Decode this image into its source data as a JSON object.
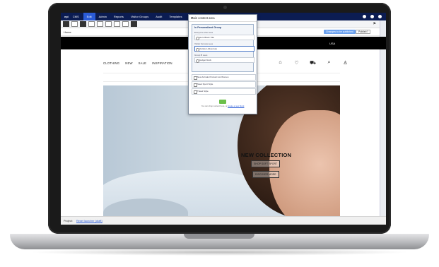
{
  "cms": {
    "logo": "epi",
    "apps_label": "CMS",
    "nav": [
      "Edit",
      "Admin",
      "Reports",
      "Visitor Groups",
      "Audit",
      "Templates"
    ],
    "active_tab": "Edit"
  },
  "page": {
    "home_label": "Home",
    "publish_status": "Changes to be published",
    "publish_button": "Publish?"
  },
  "site": {
    "locale": "USA",
    "menu": [
      "CLOTHING",
      "NEW",
      "SALE",
      "INSPIRATION"
    ],
    "icons": [
      "store-icon",
      "wishlist-icon",
      "cart-icon",
      "search-icon",
      "user-icon"
    ],
    "hero": {
      "title": "NEW COLLECTION",
      "primary_button": "SHOP SOFT SPORT",
      "secondary_button": "DISCOVER MORE"
    }
  },
  "modal": {
    "title": "Main content area",
    "group_title": "In Personalized Group",
    "conditions": [
      {
        "label": "Everyone else sees",
        "item": "Hero Block Title"
      },
      {
        "label": "Visitor Groups sees",
        "item": "Outdoor Adventure"
      },
      {
        "label": "Group B sees",
        "item": "budget block"
      }
    ],
    "blocks": [
      "New Arrivals Product List Women",
      "Steel Sport Style",
      "Travel Style"
    ],
    "drop_hint": "You can drop content here, or",
    "drop_link": "create a new block"
  },
  "status": {
    "project_label": "Project:",
    "project_link": "Reset launcher (draft)"
  },
  "colors": {
    "cms_bar": "#0b1c52",
    "accent": "#2a5bd7",
    "publish_badge": "#6aa0ee",
    "drop_icon": "#6cc04a"
  }
}
